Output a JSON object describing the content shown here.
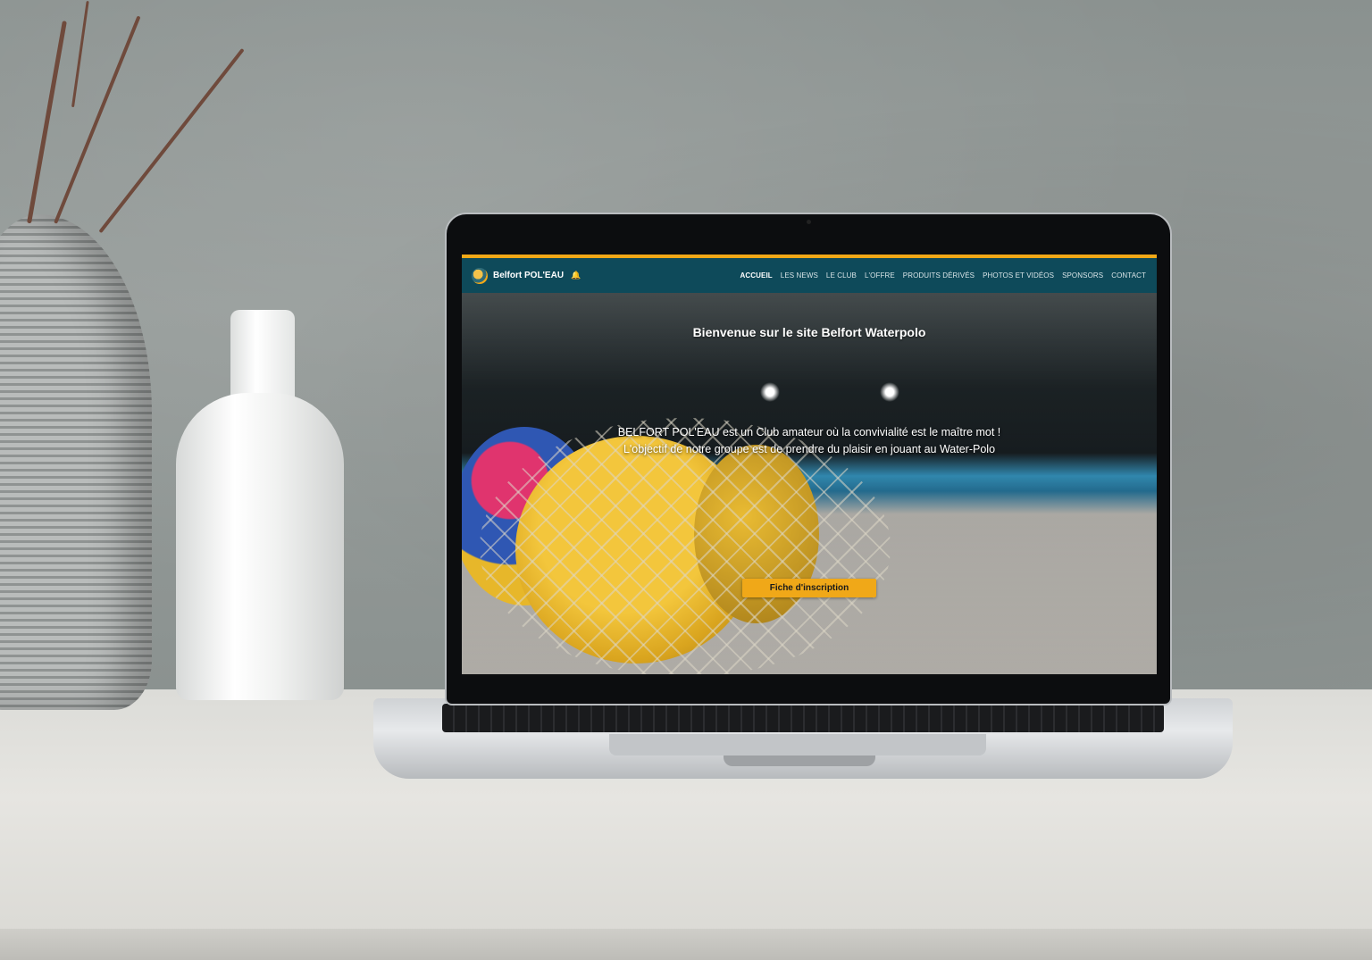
{
  "site": {
    "brand_name": "Belfort POL'EAU",
    "logo_icon": "club-logo-icon",
    "notification_icon": "bell-icon",
    "colors": {
      "nav_bg": "#0e4a5a",
      "accent": "#f0a818",
      "text": "#ffffff"
    }
  },
  "nav": {
    "items": [
      {
        "label": "ACCUEIL",
        "active": true
      },
      {
        "label": "LES NEWS"
      },
      {
        "label": "LE CLUB"
      },
      {
        "label": "L'OFFRE"
      },
      {
        "label": "PRODUITS DÉRIVÉS"
      },
      {
        "label": "PHOTOS ET VIDÉOS"
      },
      {
        "label": "SPONSORS"
      },
      {
        "label": "CONTACT"
      }
    ]
  },
  "hero": {
    "title": "Bienvenue sur le site Belfort Waterpolo",
    "line1": "BELFORT POL'EAU est un Club amateur où la convivialité est le maître mot !",
    "line2": "L'objectif de notre groupe est de prendre du plaisir en jouant au Water-Polo",
    "cta_label": "Fiche d'inscription"
  }
}
